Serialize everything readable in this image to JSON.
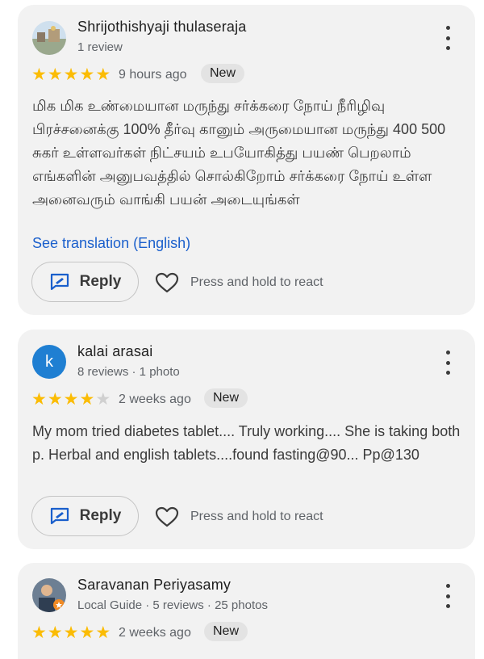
{
  "reviews": [
    {
      "name": "Shrijothishyaji thulaseraja",
      "meta": "1 review",
      "rating": 5,
      "time": "9 hours ago",
      "badge": "New",
      "text": "மிக மிக உண்மையான மருந்து சர்க்கரை நோய் நீரிழிவு பிரச்சனைக்கு 100% தீர்வு கானும் அருமையான மருந்து 400 500 சுகர் உள்ளவர்கள் நிட்சயம் உபயோகித்து பயண் பெறலாம் எங்களின் அனுபவத்தில் சொல்கிறோம் சர்க்கரை நோய் உள்ள அனைவரும் வாங்கி பயன் அடையுங்கள்",
      "translate": "See translation (English)",
      "reply": "Reply",
      "react": "Press and hold to react"
    },
    {
      "name": "kalai arasai",
      "avatar_letter": "k",
      "meta": "8 reviews · 1 photo",
      "rating": 4,
      "time": "2 weeks ago",
      "badge": "New",
      "text": "My mom tried diabetes tablet.... Truly working.... She is taking both p. Herbal and english tablets....found fasting@90... Pp@130",
      "reply": "Reply",
      "react": "Press and hold to react"
    },
    {
      "name": "Saravanan Periyasamy",
      "meta": "Local Guide · 5 reviews · 25 photos",
      "rating": 5,
      "time": "2 weeks ago",
      "badge": "New"
    }
  ],
  "colors": {
    "star": "#fbbc04",
    "link": "#1a5fcc",
    "card": "#f2f2f2"
  }
}
